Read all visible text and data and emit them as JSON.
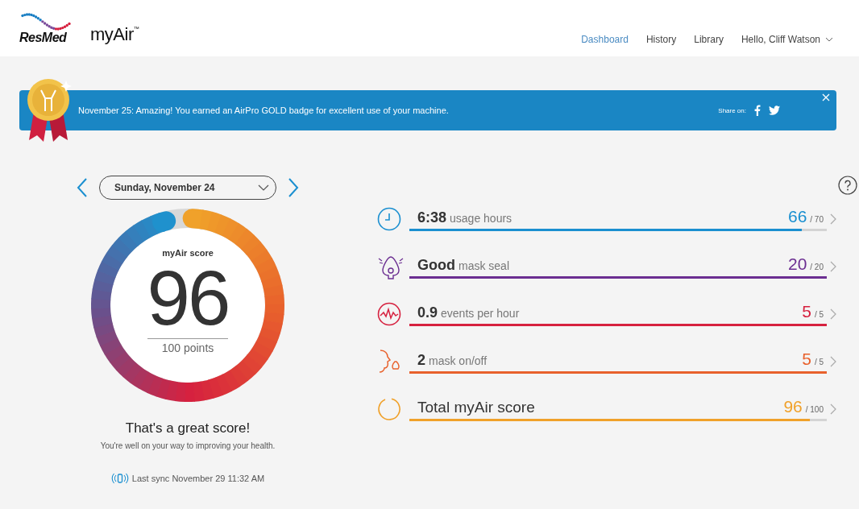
{
  "header": {
    "brand": "ResMed",
    "product": "myAir",
    "trademark": "™",
    "nav": [
      {
        "label": "Dashboard",
        "selected": true
      },
      {
        "label": "History",
        "selected": false
      },
      {
        "label": "Library",
        "selected": false
      }
    ],
    "user": "Hello, Cliff Watson"
  },
  "banner": {
    "message": "November 25: Amazing! You earned an AirPro GOLD badge for excellent use of your machine.",
    "share_label": "Share on:"
  },
  "date_selector": {
    "value": "Sunday, November 24"
  },
  "gauge": {
    "title": "myAir score",
    "score": "96",
    "level": 0.96,
    "caption": "100 points"
  },
  "verdict": {
    "title": "That's a great score!",
    "subtitle": "You're well on your way to improving your health."
  },
  "sync": "Last sync November 29 11:32 AM",
  "metrics": [
    {
      "kind": "clock",
      "value": "6:38",
      "label": "usage hours",
      "points": "66",
      "max": "/ 70",
      "level": 0.94,
      "color": "#1a8fd0"
    },
    {
      "kind": "mask",
      "value": "Good",
      "label": "mask seal",
      "points": "20",
      "max": "/ 20",
      "level": 1,
      "color": "#6b2e91"
    },
    {
      "kind": "events",
      "value": "0.9",
      "label": "events per hour",
      "points": "5",
      "max": "/ 5",
      "level": 1,
      "color": "#d6213f"
    },
    {
      "kind": "face",
      "value": "2",
      "label": "mask on/off",
      "points": "5",
      "max": "/ 5",
      "level": 1,
      "color": "#e8612c"
    },
    {
      "kind": "total",
      "label": "Total myAir score",
      "points": "96",
      "max": "/ 100",
      "level": 0.96,
      "color": "#f0a12a"
    }
  ]
}
